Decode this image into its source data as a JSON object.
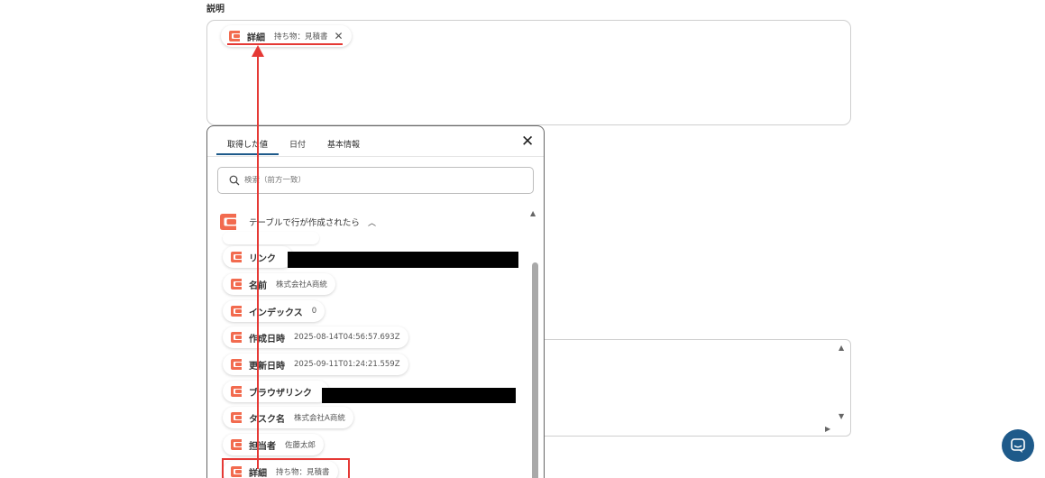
{
  "field": {
    "label": "説明"
  },
  "description_chip": {
    "label": "詳細",
    "value": "持ち物：見積書",
    "remove_icon": "close-icon"
  },
  "picker": {
    "tabs": [
      {
        "label": "取得した値",
        "active": true
      },
      {
        "label": "日付"
      },
      {
        "label": "基本情報"
      }
    ],
    "close_icon": "close-icon",
    "search": {
      "placeholder": "検索（前方一致）",
      "icon": "search-icon"
    },
    "group": {
      "title": "テーブルで行が作成されたら",
      "icon": "app-logo-icon",
      "toggle_icon": "chevron-up-icon"
    },
    "items": [
      {
        "label": "リンク",
        "value": ""
      },
      {
        "label": "名前",
        "value": "株式会社A商統"
      },
      {
        "label": "インデックス",
        "value": "0"
      },
      {
        "label": "作成日時",
        "value": "2025-08-14T04:56:57.693Z"
      },
      {
        "label": "更新日時",
        "value": "2025-09-11T01:24:21.559Z"
      },
      {
        "label": "ブラウザリンク",
        "value": ""
      },
      {
        "label": "タスク名",
        "value": "株式会社A商統"
      },
      {
        "label": "担当者",
        "value": "佐藤太郎"
      },
      {
        "label": "詳細",
        "value": "持ち物：見積書"
      }
    ]
  },
  "colors": {
    "accent": "#1e5a8a",
    "annotation": "#e53935",
    "logo": "#f26b4f"
  }
}
